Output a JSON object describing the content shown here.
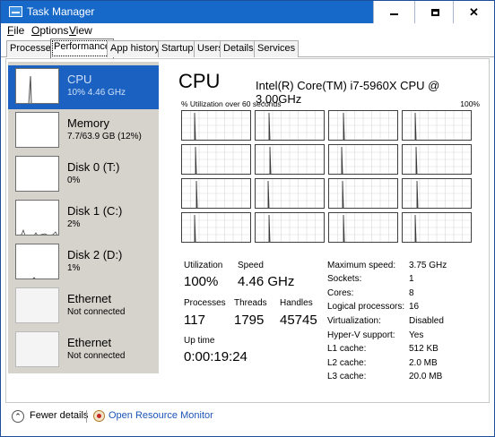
{
  "window": {
    "title": "Task Manager",
    "controls": {
      "minimize": "—",
      "maximize": "□",
      "close": "✕"
    }
  },
  "menu": {
    "items": [
      {
        "label": "File",
        "mnemonic": "F",
        "rest": "ile"
      },
      {
        "label": "Options",
        "mnemonic": "O",
        "rest": "ptions"
      },
      {
        "label": "View",
        "mnemonic": "V",
        "rest": "iew"
      }
    ]
  },
  "tabs": [
    {
      "label": "Processes",
      "active": false
    },
    {
      "label": "Performance",
      "active": true
    },
    {
      "label": "App history",
      "active": false
    },
    {
      "label": "Startup",
      "active": false
    },
    {
      "label": "Users",
      "active": false
    },
    {
      "label": "Details",
      "active": false
    },
    {
      "label": "Services",
      "active": false
    }
  ],
  "sidebar": {
    "items": [
      {
        "name": "CPU",
        "value": "10% 4.46 GHz",
        "selected": true
      },
      {
        "name": "Memory",
        "value": "7.7/63.9 GB (12%)",
        "selected": false
      },
      {
        "name": "Disk 0 (T:)",
        "value": "0%",
        "selected": false
      },
      {
        "name": "Disk 1 (C:)",
        "value": "2%",
        "selected": false
      },
      {
        "name": "Disk 2 (D:)",
        "value": "1%",
        "selected": false
      },
      {
        "name": "Ethernet",
        "value": "Not connected",
        "selected": false
      },
      {
        "name": "Ethernet",
        "value": "Not connected",
        "selected": false
      }
    ]
  },
  "main": {
    "title": "CPU",
    "model": "Intel(R) Core(TM) i7-5960X CPU @ 3.00GHz",
    "graph_label": "% Utilization over 60 seconds",
    "graph_max": "100%",
    "core_count": 16,
    "stats": {
      "utilization_label": "Utilization",
      "utilization": "100%",
      "speed_label": "Speed",
      "speed": "4.46 GHz",
      "processes_label": "Processes",
      "processes": "117",
      "threads_label": "Threads",
      "threads": "1795",
      "handles_label": "Handles",
      "handles": "45745",
      "uptime_label": "Up time",
      "uptime": "0:00:19:24"
    },
    "specs": [
      {
        "label": "Maximum speed:",
        "value": "3.75 GHz"
      },
      {
        "label": "Sockets:",
        "value": "1"
      },
      {
        "label": "Cores:",
        "value": "8"
      },
      {
        "label": "Logical processors:",
        "value": "16"
      },
      {
        "label": "Virtualization:",
        "value": "Disabled"
      },
      {
        "label": "Hyper-V support:",
        "value": "Yes"
      },
      {
        "label": "L1 cache:",
        "value": "512 KB"
      },
      {
        "label": "L2 cache:",
        "value": "2.0 MB"
      },
      {
        "label": "L3 cache:",
        "value": "20.0 MB"
      }
    ]
  },
  "footer": {
    "fewer_details": "Fewer details",
    "open_resource_monitor": "Open Resource Monitor"
  },
  "colors": {
    "titlebar": "#1668c9",
    "selected": "#1a61c2",
    "sidebar_bg": "#d6d3cc",
    "link": "#1c55b8"
  }
}
